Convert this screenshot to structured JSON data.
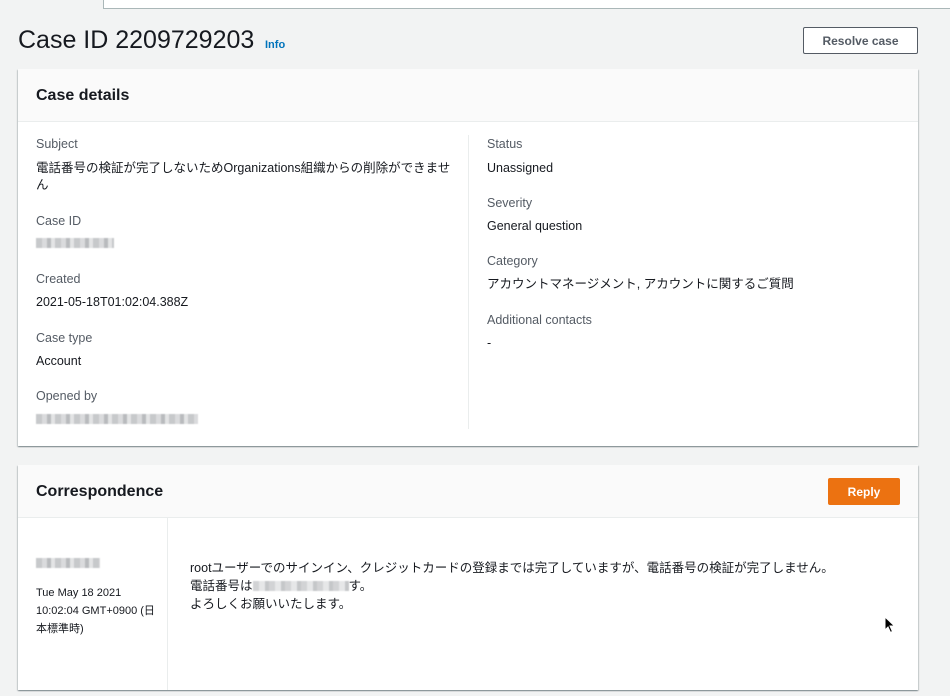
{
  "header": {
    "title": "Case ID 2209729203",
    "info_label": "Info",
    "resolve_label": "Resolve case"
  },
  "case_details": {
    "title": "Case details",
    "subject": {
      "label": "Subject",
      "value": "電話番号の検証が完了しないためOrganizations組織からの削除ができません"
    },
    "case_id": {
      "label": "Case ID"
    },
    "created": {
      "label": "Created",
      "value": "2021-05-18T01:02:04.388Z"
    },
    "case_type": {
      "label": "Case type",
      "value": "Account"
    },
    "opened_by": {
      "label": "Opened by"
    },
    "status": {
      "label": "Status",
      "value": "Unassigned"
    },
    "severity": {
      "label": "Severity",
      "value": "General question"
    },
    "category": {
      "label": "Category",
      "value": "アカウントマネージメント, アカウントに関するご質問"
    },
    "additional_contacts": {
      "label": "Additional contacts",
      "value": "-"
    }
  },
  "correspondence": {
    "title": "Correspondence",
    "reply_label": "Reply",
    "message": {
      "date": "Tue May 18 2021 10:02:04 GMT+0900 (日本標準時)",
      "line1": "rootユーザーでのサインイン、クレジットカードの登録までは完了していますが、電話番号の検証が完了しません。",
      "line2_prefix": "電話番号は",
      "line2_suffix": "す。",
      "line3": "よろしくお願いいたします。"
    }
  },
  "icons": {
    "cursor": "mouse-pointer-icon"
  }
}
